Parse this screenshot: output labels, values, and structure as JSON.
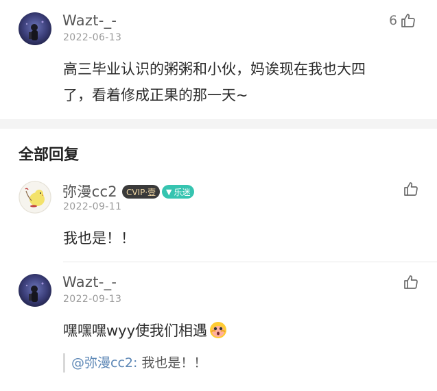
{
  "main_comment": {
    "username": "Wazt-_-",
    "date": "2022-06-13",
    "like_count": "6",
    "content_line1": "高三毕业认识的粥粥和小伙，妈诶现在我也大四",
    "content_line2": "了，看着修成正果的那一天~"
  },
  "replies_section": {
    "title": "全部回复"
  },
  "replies": [
    {
      "username": "弥漫cc2",
      "badge_vip": "CVIP·壹",
      "badge_fan": "乐迷",
      "date": "2022-09-11",
      "content": "我也是！！"
    },
    {
      "username": "Wazt-_-",
      "date": "2022-09-13",
      "content": "嘿嘿嘿wyy使我们相遇",
      "quote_mention": "@弥漫cc2:",
      "quote_text": " 我也是！！"
    }
  ],
  "colors": {
    "accent_mention": "#5b86b5",
    "fan_badge": "#36c4b0",
    "vip_badge": "#3a3a3a"
  },
  "icons": {
    "like": "thumbs-up-icon",
    "emoji": "shy-face-emoji-icon"
  }
}
